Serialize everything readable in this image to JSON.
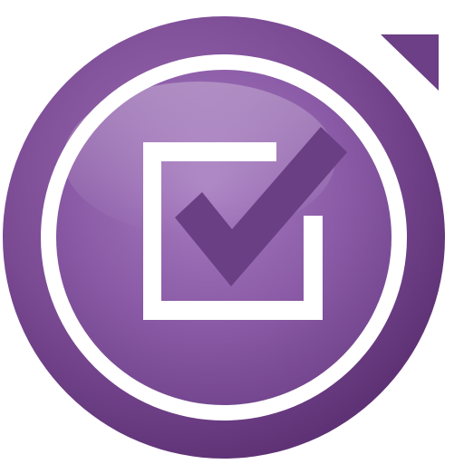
{
  "icon": {
    "name": "checkbox-checkmark-app-icon",
    "colors": {
      "outer_ring": "#7a4a93",
      "outer_ring_dark": "#5b2f72",
      "white_ring": "#ffffff",
      "inner_disc": "#8a5aa6",
      "inner_disc_light": "#a77cc0",
      "inner_disc_dark": "#6c3f86",
      "checkmark": "#6a3f83",
      "checkbox": "#ffffff",
      "corner_triangle": "#6c3f86"
    }
  }
}
